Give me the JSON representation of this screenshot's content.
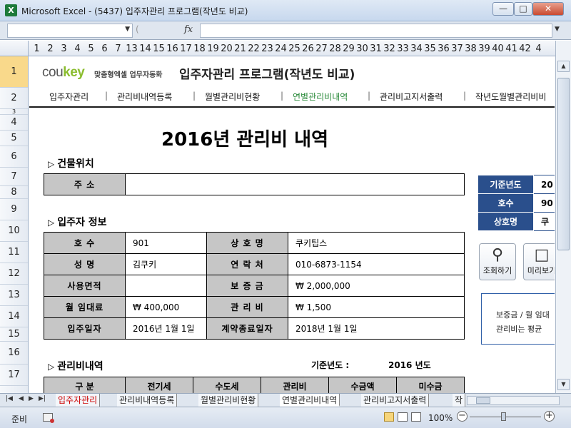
{
  "window": {
    "app_icon": "X",
    "title": "Microsoft Excel - (5437) 입주자관리 프로그램(작년도 비교)",
    "min": "—",
    "max": "□",
    "close": "✕"
  },
  "formula_bar": {
    "fx": "fx"
  },
  "columns": [
    "1",
    "2",
    "3",
    "4",
    "5",
    "6",
    "7",
    "13",
    "14",
    "15",
    "16",
    "17",
    "18",
    "19",
    "20",
    "21",
    "22",
    "23",
    "24",
    "25",
    "26",
    "27",
    "28",
    "29",
    "30",
    "31",
    "32",
    "33",
    "34",
    "35",
    "36",
    "37",
    "38",
    "39",
    "40",
    "41",
    "42",
    "4"
  ],
  "rows": [
    "1",
    "2",
    "3",
    "4",
    "5",
    "6",
    "7",
    "8",
    "9",
    "10",
    "11",
    "12",
    "13",
    "14",
    "15",
    "16",
    "17"
  ],
  "header": {
    "logo_main": "cou",
    "logo_key": "key",
    "logo_sub": "맞춤형엑셀 업무자동화",
    "app_title": "입주자관리 프로그램(작년도 비교)"
  },
  "nav": [
    {
      "label": "입주자관리"
    },
    {
      "label": "관리비내역등록"
    },
    {
      "label": "월별관리비현황"
    },
    {
      "label": "연별관리비내역"
    },
    {
      "label": "관리비고지서출력"
    },
    {
      "label": "작년도월별관리비비"
    }
  ],
  "report_title": "2016년 관리비 내역",
  "building": {
    "section": "건물위치",
    "address_label": "주 소",
    "address_value": ""
  },
  "tenant": {
    "section": "입주자 정보",
    "room_label": "호 수",
    "room_value": "901",
    "shop_label": "상 호 명",
    "shop_value": "쿠키팁스",
    "name_label": "성 명",
    "name_value": "김쿠키",
    "contact_label": "연 락 처",
    "contact_value": "010-6873-1154",
    "area_label": "사용면적",
    "area_value": "",
    "deposit_label": "보 증 금",
    "deposit_value": "₩ 2,000,000",
    "rent_label": "월 임대료",
    "rent_value": "₩ 400,000",
    "fee_label": "관 리 비",
    "fee_value": "₩ 1,500",
    "movein_label": "입주일자",
    "movein_value": "2016년 1월 1일",
    "contract_end_label": "계약종료일자",
    "contract_end_value": "2018년 1월 1일"
  },
  "info_box": {
    "year_label": "기준년도",
    "year_value": "20",
    "room_label": "호수",
    "room_value": "90",
    "shop_label": "상호명",
    "shop_value": "쿠"
  },
  "buttons": {
    "search_label": "조회하기",
    "preview_label": "미리보기"
  },
  "note": {
    "line1": "보증금 / 월 임대",
    "line2": "관리비는 평균"
  },
  "fees": {
    "section": "관리비내역",
    "base_year_label": "기준년도 :",
    "base_year_value": "2016 년도",
    "columns": [
      "구 분",
      "전기세",
      "수도세",
      "관리비",
      "수금액",
      "미수금"
    ]
  },
  "sheet_tabs": [
    {
      "label": "입주자관리"
    },
    {
      "label": "관리비내역등록"
    },
    {
      "label": "월별관리비현황"
    },
    {
      "label": "연별관리비내역"
    },
    {
      "label": "관리비고지서출력"
    },
    {
      "label": "작"
    }
  ],
  "status": {
    "ready": "준비",
    "zoom": "100%",
    "zoom_minus": "−",
    "zoom_plus": "+"
  }
}
